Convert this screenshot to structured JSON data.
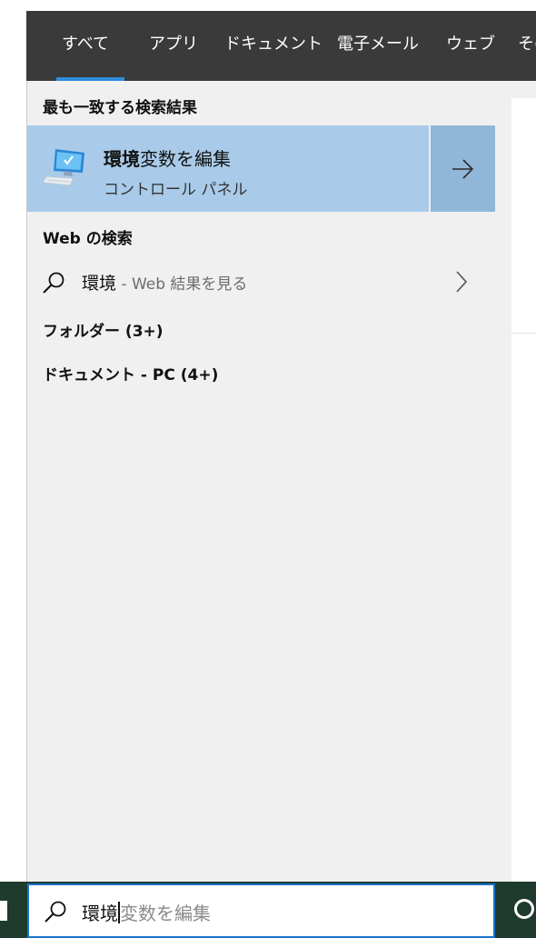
{
  "tabs": [
    {
      "label": "すべて",
      "active": true
    },
    {
      "label": "アプリ",
      "active": false
    },
    {
      "label": "ドキュメント",
      "active": false
    },
    {
      "label": "電子メール",
      "active": false
    },
    {
      "label": "ウェブ",
      "active": false
    },
    {
      "label": "その",
      "active": false
    }
  ],
  "best_match": {
    "section_title": "最も一致する検索結果",
    "title_bold": "環境",
    "title_rest": "変数を編集",
    "subtitle": "コントロール パネル",
    "icon": "control-panel-monitor-icon"
  },
  "web_search": {
    "section_title": "Web の検索",
    "query": "環境",
    "hint": " - Web 結果を見る"
  },
  "groups": {
    "folders": "フォルダー (3+)",
    "documents": "ドキュメント - PC (4+)"
  },
  "search_box": {
    "typed": "環境",
    "suggestion": "変数を編集"
  },
  "colors": {
    "tabbar_bg": "#3a3a3a",
    "accent": "#2e8ee0",
    "selected_bg": "#a9cbe9",
    "selected_arrow_bg": "#91b7d8",
    "panel_bg": "#f0f0f0",
    "taskbar_bg": "#1f3b2e"
  }
}
